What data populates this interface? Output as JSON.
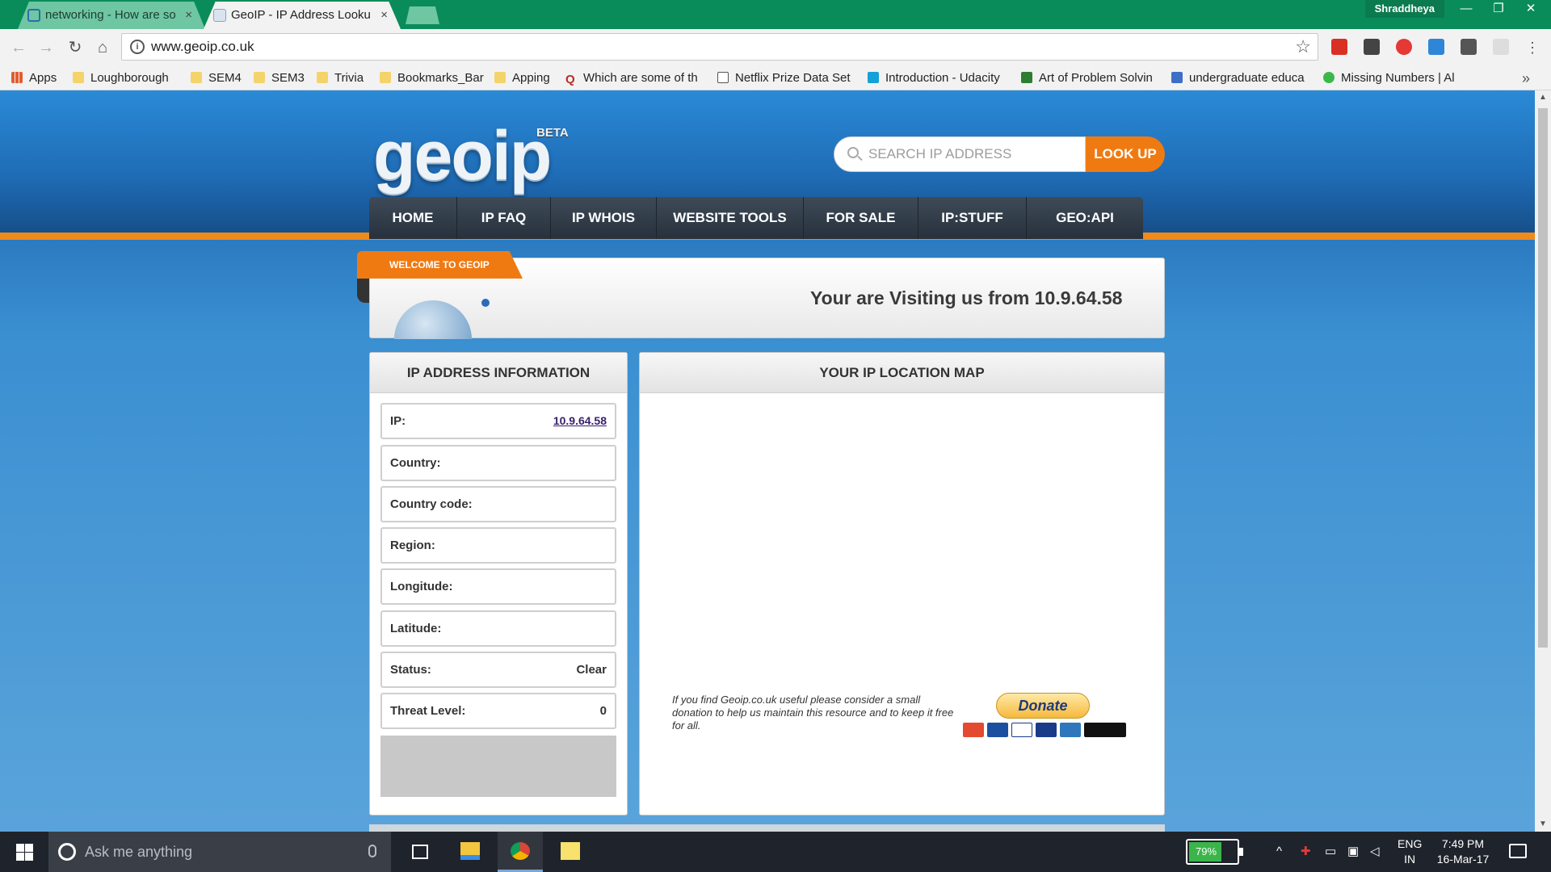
{
  "browser": {
    "tabs": [
      {
        "label": "networking - How are so",
        "close": "×"
      },
      {
        "label": "GeoIP - IP Address Looku",
        "close": "×"
      }
    ],
    "profile": "Shraddheya",
    "window_controls": {
      "minimize": "—",
      "restore": "❐",
      "close": "✕"
    },
    "nav": {
      "back": "←",
      "forward": "→",
      "reload": "↻",
      "home": "⌂"
    },
    "url": "www.geoip.co.uk",
    "info_icon": "i",
    "star": "☆",
    "bookmarks": [
      {
        "label": "Apps",
        "icon": "apps"
      },
      {
        "label": "Loughborough",
        "icon": "folder"
      },
      {
        "label": "SEM4",
        "icon": "folder"
      },
      {
        "label": "SEM3",
        "icon": "folder"
      },
      {
        "label": "Trivia",
        "icon": "folder"
      },
      {
        "label": "Bookmarks_Bar",
        "icon": "folder"
      },
      {
        "label": "Apping",
        "icon": "folder"
      },
      {
        "label": "Which are some of th",
        "icon": "quora"
      },
      {
        "label": "Netflix Prize Data Set",
        "icon": "doc"
      },
      {
        "label": "Introduction - Udacity",
        "icon": "udacity"
      },
      {
        "label": "Art of Problem Solvin",
        "icon": "aops"
      },
      {
        "label": "undergraduate educa",
        "icon": "me"
      },
      {
        "label": "Missing Numbers | Al",
        "icon": "h"
      }
    ],
    "bookmarks_more": "»",
    "quora_glyph": "Q"
  },
  "site": {
    "logo": "geoip",
    "beta": "BETA",
    "search": {
      "placeholder": "SEARCH IP ADDRESS",
      "button": "LOOK UP"
    },
    "menu": [
      "HOME",
      "IP FAQ",
      "IP WHOIS",
      "WEBSITE TOOLS",
      "FOR SALE",
      "IP:STUFF",
      "GEO:API"
    ],
    "welcome_ribbon": "WELCOME TO GEOIP",
    "visiting": "Your are Visiting us from 10.9.64.58",
    "info": {
      "title": "IP ADDRESS INFORMATION",
      "rows": [
        {
          "label": "IP:",
          "value": "10.9.64.58"
        },
        {
          "label": "Country:",
          "value": ""
        },
        {
          "label": "Country code:",
          "value": ""
        },
        {
          "label": "Region:",
          "value": ""
        },
        {
          "label": "Longitude:",
          "value": ""
        },
        {
          "label": "Latitude:",
          "value": ""
        },
        {
          "label": "Status:",
          "value": "Clear"
        },
        {
          "label": "Threat Level:",
          "value": "0"
        }
      ]
    },
    "map": {
      "title": "YOUR IP LOCATION MAP",
      "donate_text": "If you find Geoip.co.uk useful please consider a small donation to help us maintain this resource and to keep it free for all.",
      "donate_button": "Donate"
    }
  },
  "taskbar": {
    "search_placeholder": "Ask me anything",
    "battery": "79%",
    "lang_1": "ENG",
    "lang_2": "IN",
    "time": "7:49 PM",
    "date": "16-Mar-17",
    "tray_up": "^"
  },
  "colors": {
    "accent_orange": "#f07a12",
    "header_blue": "#1f6cb6",
    "menu_dark": "#27313d",
    "tab_green": "#0a8c5a"
  }
}
